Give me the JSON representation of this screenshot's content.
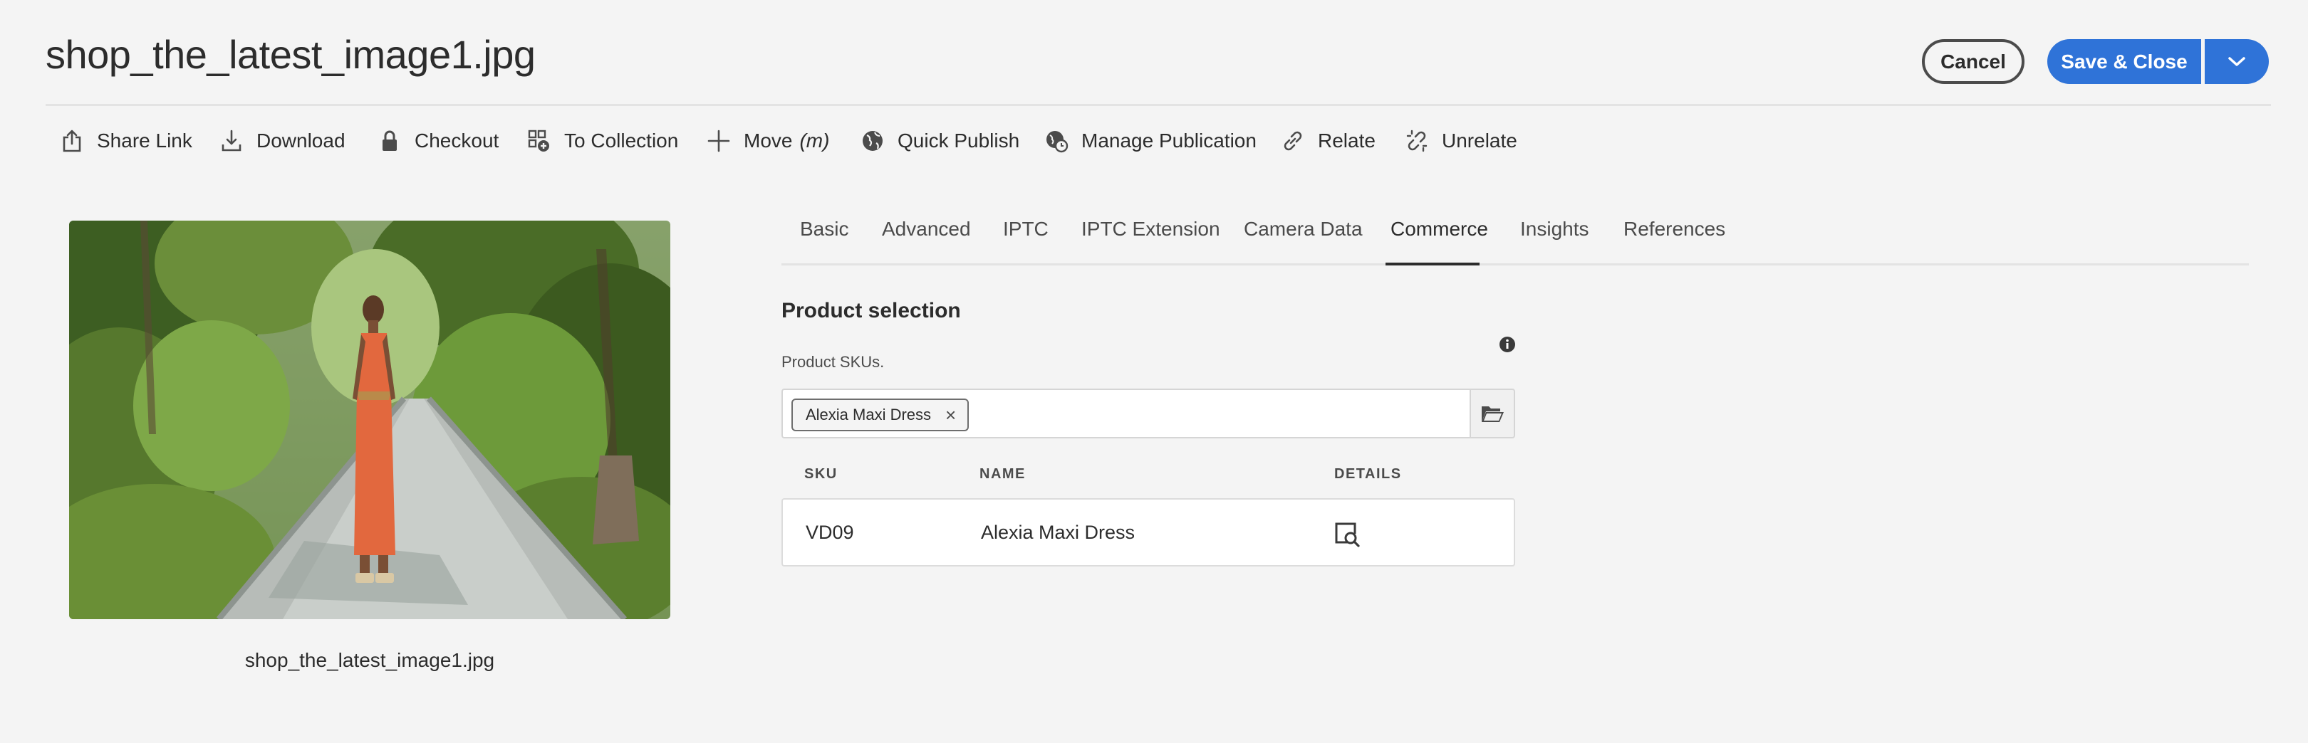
{
  "header": {
    "title": "shop_the_latest_image1.jpg",
    "cancel_label": "Cancel",
    "save_label": "Save & Close"
  },
  "toolbar": {
    "items": [
      {
        "label": "Share Link",
        "icon": "share-icon"
      },
      {
        "label": "Download",
        "icon": "download-icon"
      },
      {
        "label": "Checkout",
        "icon": "lock-icon"
      },
      {
        "label": "To Collection",
        "icon": "add-to-collection-icon"
      },
      {
        "label": "Move",
        "hint": "(m)",
        "icon": "move-icon"
      },
      {
        "label": "Quick Publish",
        "icon": "globe-icon"
      },
      {
        "label": "Manage Publication",
        "icon": "globe-clock-icon"
      },
      {
        "label": "Relate",
        "icon": "link-icon"
      },
      {
        "label": "Unrelate",
        "icon": "unlink-icon"
      }
    ]
  },
  "preview": {
    "caption": "shop_the_latest_image1.jpg"
  },
  "tabs": [
    {
      "label": "Basic"
    },
    {
      "label": "Advanced"
    },
    {
      "label": "IPTC"
    },
    {
      "label": "IPTC Extension"
    },
    {
      "label": "Camera Data"
    },
    {
      "label": "Commerce",
      "active": true
    },
    {
      "label": "Insights"
    },
    {
      "label": "References"
    }
  ],
  "commerce": {
    "section_title": "Product selection",
    "field_label": "Product SKUs.",
    "selected_tag": "Alexia Maxi Dress",
    "table": {
      "headers": [
        "SKU",
        "NAME",
        "DETAILS"
      ],
      "rows": [
        {
          "sku": "VD09",
          "name": "Alexia Maxi Dress"
        }
      ]
    }
  },
  "colors": {
    "accent": "#2f73d8",
    "background": "#f4f4f4",
    "text": "#2c2c2c"
  }
}
